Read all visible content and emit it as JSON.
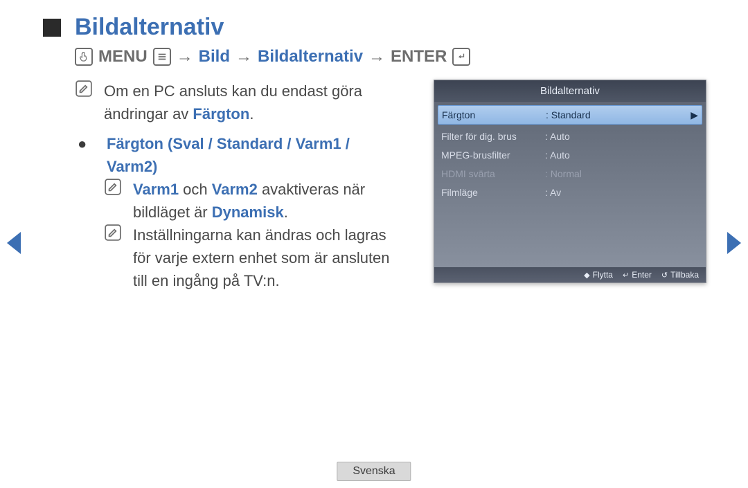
{
  "title": "Bildalternativ",
  "breadcrumb": {
    "menu_label": "MENU",
    "arrow": "→",
    "b1": "Bild",
    "b2": "Bildalternativ",
    "enter_label": "ENTER"
  },
  "content": {
    "note1_a": "Om en PC ansluts kan du endast göra ändringar av ",
    "note1_b": "Färgton",
    "note1_c": ".",
    "option_heading": "Färgton (Sval / Standard / Varm1 / Varm2)",
    "note2_a": "Varm1",
    "note2_b": " och ",
    "note2_c": "Varm2",
    "note2_d": " avaktiveras när bildläget är ",
    "note2_e": "Dynamisk",
    "note2_f": ".",
    "note3": "Inställningarna kan ändras och lagras för varje extern enhet som är ansluten till en ingång på TV:n."
  },
  "panel": {
    "title": "Bildalternativ",
    "rows": [
      {
        "label": "Färgton",
        "value": ": Standard",
        "highlight": true,
        "arrow": "▶"
      },
      {
        "label": "Filter för dig. brus",
        "value": ": Auto"
      },
      {
        "label": "MPEG-brusfilter",
        "value": ": Auto"
      },
      {
        "label": "HDMI svärta",
        "value": ": Normal",
        "dim": true
      },
      {
        "label": "Filmläge",
        "value": ": Av"
      }
    ],
    "footer": {
      "move": "Flytta",
      "enter": "Enter",
      "return": "Tillbaka"
    }
  },
  "language_label": "Svenska"
}
